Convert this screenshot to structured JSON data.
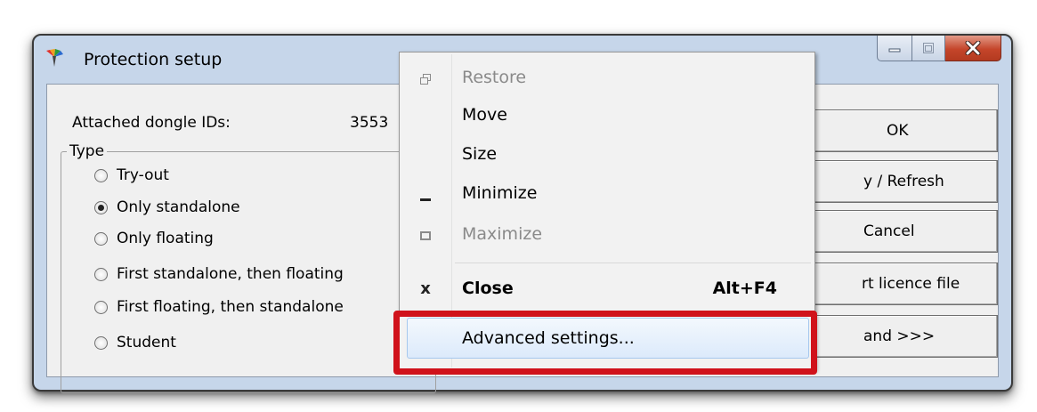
{
  "window": {
    "title": "Protection setup",
    "icon": "app-logo-icon",
    "caption_buttons": [
      "minimize-icon",
      "maximize-icon",
      "close-icon"
    ]
  },
  "dongle": {
    "label": "Attached dongle IDs:",
    "value": "3553"
  },
  "type_group": {
    "legend": "Type",
    "options": [
      {
        "label": "Try-out",
        "checked": false
      },
      {
        "label": "Only standalone",
        "checked": true
      },
      {
        "label": "Only floating",
        "checked": false
      },
      {
        "label": "First standalone, then floating",
        "checked": false
      },
      {
        "label": "First floating, then standalone",
        "checked": false
      },
      {
        "label": "Student",
        "checked": false
      }
    ]
  },
  "buttons": {
    "ok": "OK",
    "apply_refresh": "y / Refresh",
    "cancel": "Cancel",
    "licence": "rt licence file",
    "expand": "and >>>"
  },
  "context_menu": {
    "restore": {
      "label": "Restore",
      "icon": "restore-icon"
    },
    "move": {
      "label": "Move"
    },
    "size": {
      "label": "Size"
    },
    "minimize": {
      "label": "Minimize",
      "icon": "minimize-icon"
    },
    "maximize": {
      "label": "Maximize",
      "icon": "maximize-icon"
    },
    "close": {
      "label": "Close",
      "shortcut": "Alt+F4",
      "icon_glyph": "x"
    },
    "advanced": {
      "label": "Advanced settings..."
    }
  },
  "colors": {
    "highlight_box": "#d0121b",
    "window_frame": "#c6d6ea",
    "close_button": "#c5452a"
  }
}
